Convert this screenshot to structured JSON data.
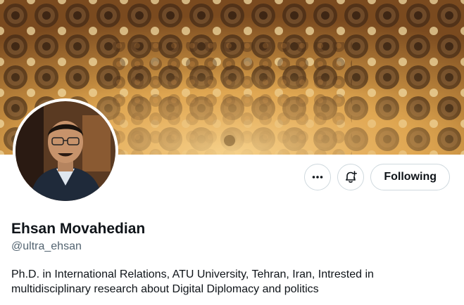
{
  "profile": {
    "display_name": "Ehsan Movahedian",
    "handle": "@ultra_ehsan",
    "bio": "Ph.D. in International Relations, ATU University, Tehran, Iran, Intrested in multidisciplinary research about Digital Diplomacy and politics"
  },
  "actions": {
    "more_icon": "more-dots-icon",
    "notify_icon": "bell-plus-icon",
    "follow_label": "Following"
  },
  "colors": {
    "text": "#0f1419",
    "secondary": "#536471",
    "border": "#cfd9de",
    "banner_gold": "#d49a3a",
    "banner_dark": "#3a2413"
  }
}
